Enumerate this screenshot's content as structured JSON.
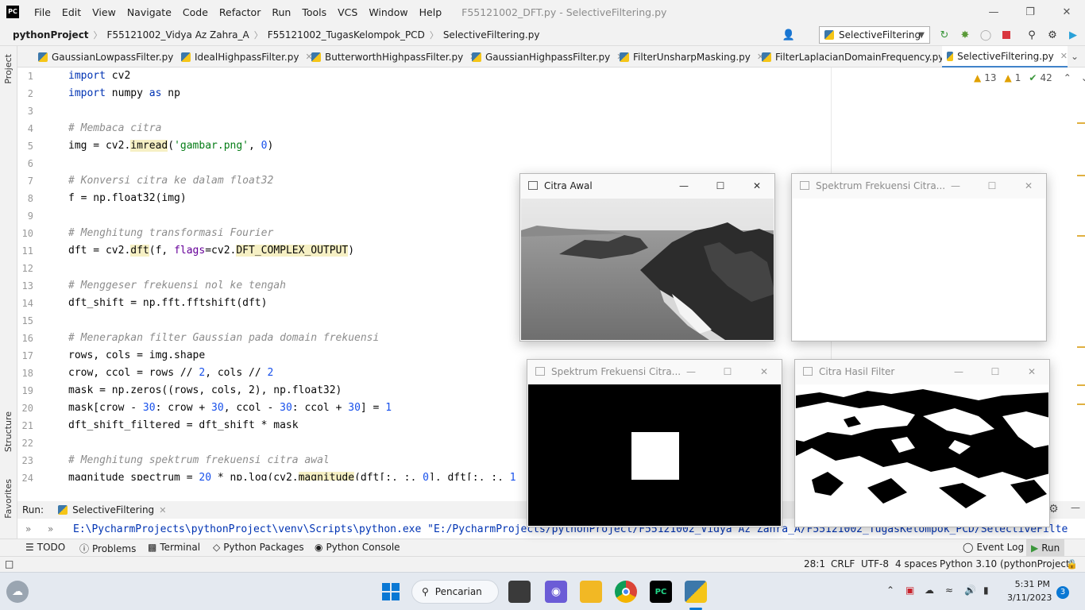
{
  "window": {
    "app_logo": "PC",
    "title": "F55121002_DFT.py - SelectiveFiltering.py",
    "menu": [
      "File",
      "Edit",
      "View",
      "Navigate",
      "Code",
      "Refactor",
      "Run",
      "Tools",
      "VCS",
      "Window",
      "Help"
    ]
  },
  "breadcrumb": [
    "pythonProject",
    "F55121002_Vidya Az Zahra_A",
    "F55121002_TugasKelompok_PCD",
    "SelectiveFiltering.py"
  ],
  "run_config": "SelectiveFiltering",
  "tabs": [
    {
      "label": "GaussianLowpassFilter.py"
    },
    {
      "label": "IdealHighpassFilter.py"
    },
    {
      "label": "ButterworthHighpassFilter.py"
    },
    {
      "label": "GaussianHighpassFilter.py"
    },
    {
      "label": "FilterUnsharpMasking.py"
    },
    {
      "label": "FilterLaplacianDomainFrequency.py"
    },
    {
      "label": "SelectiveFiltering.py"
    }
  ],
  "left_strip": {
    "project": "Project",
    "structure": "Structure",
    "favorites": "Favorites"
  },
  "inspections": {
    "warnings": "13",
    "weak_warnings": "1",
    "ok": "42"
  },
  "line_numbers": [
    "1",
    "2",
    "3",
    "4",
    "5",
    "6",
    "7",
    "8",
    "9",
    "10",
    "11",
    "12",
    "13",
    "14",
    "15",
    "16",
    "17",
    "18",
    "19",
    "20",
    "21",
    "22",
    "23",
    "24"
  ],
  "code": {
    "l1_kw": "import",
    "l1_rest": " cv2",
    "l2_kw": "import",
    "l2_mid": " numpy ",
    "l2_as": "as",
    "l2_rest": " np",
    "l4": "# Membaca citra",
    "l5_a": "img = cv2.",
    "l5_fn": "imread",
    "l5_b": "(",
    "l5_str": "'gambar.png'",
    "l5_c": ", ",
    "l5_num": "0",
    "l5_d": ")",
    "l7": "# Konversi citra ke dalam float32",
    "l8": "f = np.float32(img)",
    "l10": "# Menghitung transformasi Fourier",
    "l11_a": "dft = cv2.",
    "l11_fn": "dft",
    "l11_b": "(f, ",
    "l11_param": "flags",
    "l11_c": "=cv2.",
    "l11_const": "DFT_COMPLEX_OUTPUT",
    "l11_d": ")",
    "l13": "# Menggeser frekuensi nol ke tengah",
    "l14": "dft_shift = np.fft.fftshift(dft)",
    "l16": "# Menerapkan filter Gaussian pada domain frekuensi",
    "l17": "rows, cols = img.shape",
    "l18_a": "crow, ccol = rows // ",
    "l18_n1": "2",
    "l18_b": ", cols // ",
    "l18_n2": "2",
    "l19": "mask = np.zeros((rows, cols, 2), np.float32)",
    "l20_a": "mask[crow - ",
    "l20_n1": "30",
    "l20_b": ": crow + ",
    "l20_n2": "30",
    "l20_c": ", ccol - ",
    "l20_n3": "30",
    "l20_d": ": ccol + ",
    "l20_n4": "30",
    "l20_e": "] = ",
    "l20_n5": "1",
    "l21": "dft_shift_filtered = dft_shift * mask",
    "l23": "# Menghitung spektrum frekuensi citra awal",
    "l24_a": "magnitude_spectrum = ",
    "l24_n1": "20",
    "l24_b": " * np.log(cv2.",
    "l24_fn": "magnitude",
    "l24_c": "(dft[:, :, ",
    "l24_n2": "0",
    "l24_d": "], dft[:, :, ",
    "l24_n3": "1"
  },
  "run_panel": {
    "label": "Run:",
    "tab": "SelectiveFiltering",
    "command": "E:\\PycharmProjects\\pythonProject\\venv\\Scripts\\python.exe \"E:/PycharmProjects/pythonProject/F55121002_Vidya Az Zahra_A/F55121002_TugasKelompok_PCD/SelectiveFilte"
  },
  "bottom_tools": [
    "TODO",
    "Problems",
    "Terminal",
    "Python Packages",
    "Python Console"
  ],
  "bottom_right_tools": [
    "Event Log",
    "Run"
  ],
  "status": {
    "position": "28:1",
    "line_sep": "CRLF",
    "encoding": "UTF-8",
    "indent": "4 spaces",
    "interpreter": "Python 3.10 (pythonProject)"
  },
  "taskbar": {
    "search": "Pencarian",
    "time": "5:31 PM",
    "date": "3/11/2023",
    "notifications": "3"
  },
  "floating_windows": {
    "citra_awal": "Citra Awal",
    "spektrum_1": "Spektrum Frekuensi Citra...",
    "spektrum_2": "Spektrum Frekuensi Citra...",
    "hasil": "Citra Hasil Filter"
  }
}
